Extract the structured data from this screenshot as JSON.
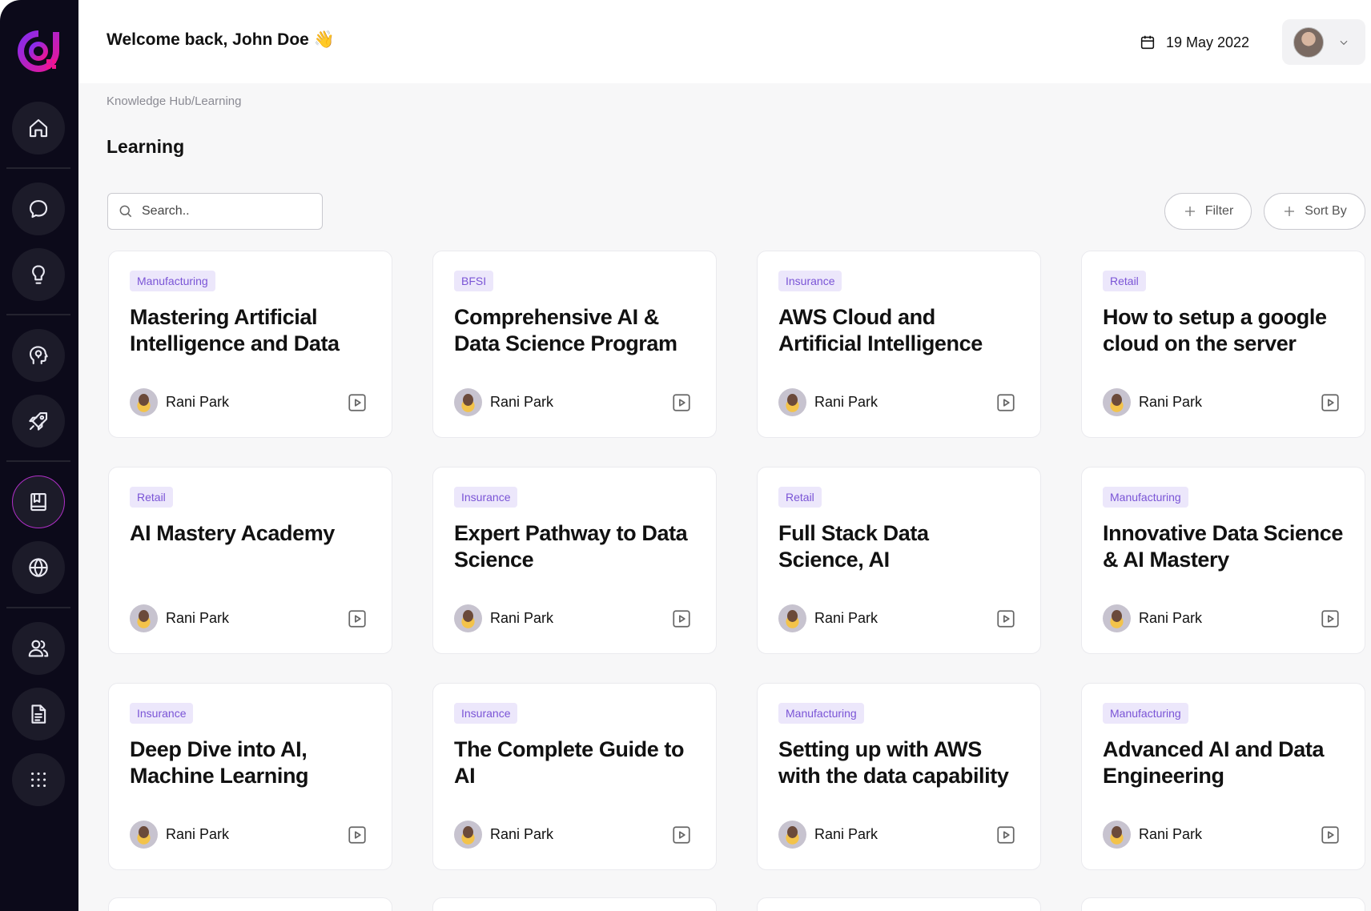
{
  "header": {
    "welcome": "Welcome back, John Doe",
    "wave_emoji": "👋",
    "date": "19 May 2022"
  },
  "breadcrumb": "Knowledge  Hub/Learning",
  "page_title": "Learning",
  "search": {
    "placeholder": "Search.."
  },
  "actions": {
    "filter_label": "Filter",
    "sort_label": "Sort By"
  },
  "colors": {
    "sidebar_bg": "#0c0a1a",
    "accent": "#b02fc8",
    "tag_bg": "#ece7fb",
    "tag_text": "#7a54d6"
  },
  "sidebar": {
    "icons": [
      "home-icon",
      "chat-icon",
      "lightbulb-icon",
      "head-idea-icon",
      "rocket-icon",
      "book-icon",
      "globe-icon",
      "users-icon",
      "document-icon",
      "apps-grid-icon"
    ],
    "active": "book-icon"
  },
  "courses": [
    {
      "tag": "Manufacturing",
      "title": "Mastering Artificial Intelligence and Data",
      "author": "Rani Park"
    },
    {
      "tag": "BFSI",
      "title": "Comprehensive AI & Data Science Program",
      "author": "Rani Park"
    },
    {
      "tag": "Insurance",
      "title": "AWS Cloud and Artificial Intelligence",
      "author": "Rani Park"
    },
    {
      "tag": "Retail",
      "title": "How to setup a google cloud on the server",
      "author": "Rani Park"
    },
    {
      "tag": "Retail",
      "title": "AI Mastery Academy",
      "author": "Rani Park"
    },
    {
      "tag": "Insurance",
      "title": "Expert Pathway to Data Science",
      "author": "Rani Park"
    },
    {
      "tag": "Retail",
      "title": "Full Stack Data Science, AI",
      "author": "Rani Park"
    },
    {
      "tag": "Manufacturing",
      "title": "Innovative Data Science & AI Mastery",
      "author": "Rani Park"
    },
    {
      "tag": "Insurance",
      "title": "Deep Dive into AI, Machine Learning",
      "author": "Rani Park"
    },
    {
      "tag": "Insurance",
      "title": "The Complete Guide to AI",
      "author": "Rani Park"
    },
    {
      "tag": "Manufacturing",
      "title": "Setting up with AWS with the data capability",
      "author": "Rani Park"
    },
    {
      "tag": "Manufacturing",
      "title": "Advanced AI and Data Engineering",
      "author": "Rani Park"
    }
  ]
}
